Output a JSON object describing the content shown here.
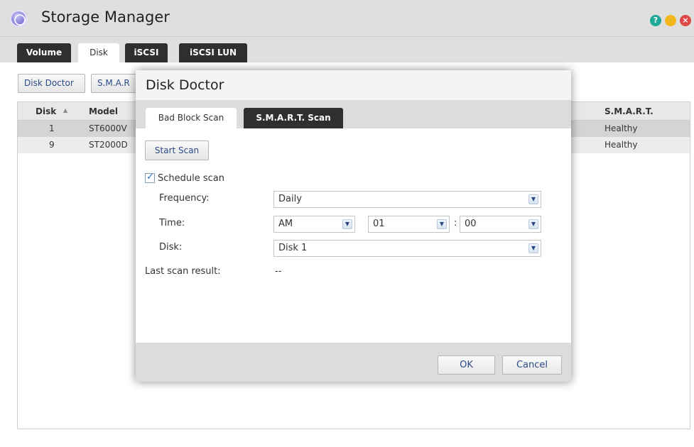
{
  "window": {
    "title": "Storage Manager",
    "controls": {
      "help": "?",
      "minimize": "",
      "close": "×"
    }
  },
  "main_tabs": [
    "Volume",
    "Disk",
    "iSCSI",
    "iSCSI LUN"
  ],
  "active_main_tab": "Disk",
  "toolbar": {
    "disk_doctor": "Disk Doctor",
    "smart": "S.M.A.R"
  },
  "grid": {
    "columns": [
      "Disk",
      "Model",
      "S.M.A.R.T."
    ],
    "sort_indicator": "▲",
    "rows": [
      {
        "disk": "1",
        "model": "ST6000V",
        "smart": "Healthy"
      },
      {
        "disk": "9",
        "model": "ST2000D",
        "smart": "Healthy"
      }
    ]
  },
  "dialog": {
    "title": "Disk Doctor",
    "tabs": [
      "Bad Block Scan",
      "S.M.A.R.T. Scan"
    ],
    "active_tab": "Bad Block Scan",
    "start_scan": "Start Scan",
    "schedule_scan": {
      "label": "Schedule scan",
      "checked": true
    },
    "frequency": {
      "label": "Frequency:",
      "value": "Daily"
    },
    "time": {
      "label": "Time:",
      "ampm": "AM",
      "hour": "01",
      "separator": ":",
      "minute": "00"
    },
    "disk": {
      "label": "Disk:",
      "value": "Disk 1"
    },
    "last_scan": {
      "label": "Last scan result:",
      "value": "--"
    },
    "ok": "OK",
    "cancel": "Cancel"
  },
  "colors": {
    "dark_tab": "#2f2f2f",
    "help": "#1fa79a",
    "minimize": "#f2b51d",
    "close": "#e04848",
    "link_text": "#2a4a86"
  },
  "icons": {
    "app": "storage-manager-icon",
    "dropdown": "chevron-down-icon"
  }
}
